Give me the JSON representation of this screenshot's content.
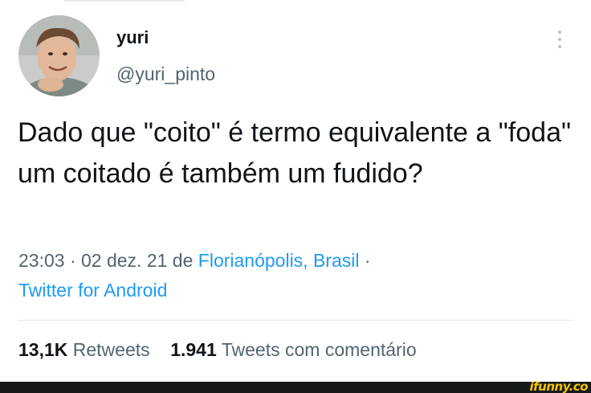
{
  "author": {
    "name": "yuri",
    "handle": "@yuri_pinto",
    "avatar_icon": "profile-photo-icon"
  },
  "tweet": {
    "text": "Dado que \"coito\" é termo equivalente a \"foda\" um coitado é também um fudido?"
  },
  "meta": {
    "time_date": "23:03 · 02 dez. 21 de ",
    "location": "Florianópolis, Brasil",
    "separator": " ·",
    "source": "Twitter for Android"
  },
  "stats": {
    "retweets_count": "13,1K",
    "retweets_label": "Retweets",
    "quotes_count": "1.941",
    "quotes_label": "Tweets com comentário"
  },
  "watermark": {
    "text": "ifunny.co"
  },
  "colors": {
    "text_primary": "#0f1419",
    "text_secondary": "#536471",
    "link": "#1d9bf0",
    "watermark": "#f5c400"
  }
}
